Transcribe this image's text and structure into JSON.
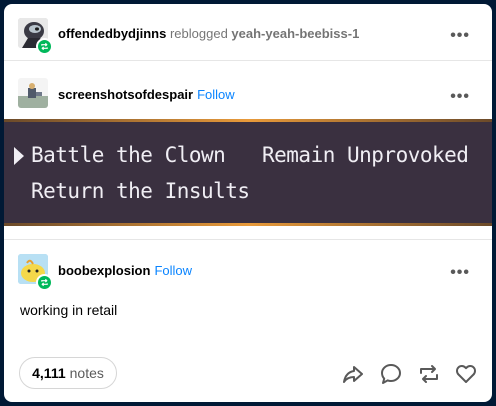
{
  "header": {
    "reblogger": "offendedbydjinns",
    "reblogged_text": "reblogged",
    "source": "yeah-yeah-beebiss-1",
    "more_label": "•••"
  },
  "post1": {
    "blogname": "screenshotsofdespair",
    "follow_label": "Follow",
    "more_label": "•••",
    "game_options": {
      "option1": "Battle the Clown",
      "option2": "Remain Unprovoked",
      "option3": "Return the Insults"
    }
  },
  "post2": {
    "blogname": "boobexplosion",
    "follow_label": "Follow",
    "more_label": "•••",
    "text": "working in retail"
  },
  "footer": {
    "notes_count": "4,111",
    "notes_label": "notes"
  },
  "colors": {
    "background": "#001935",
    "accent": "#0a84ff",
    "reblog_green": "#00b85b"
  },
  "icons": [
    "share-icon",
    "reply-icon",
    "reblog-icon",
    "like-icon",
    "reblog-badge-icon",
    "more-options-icon"
  ]
}
